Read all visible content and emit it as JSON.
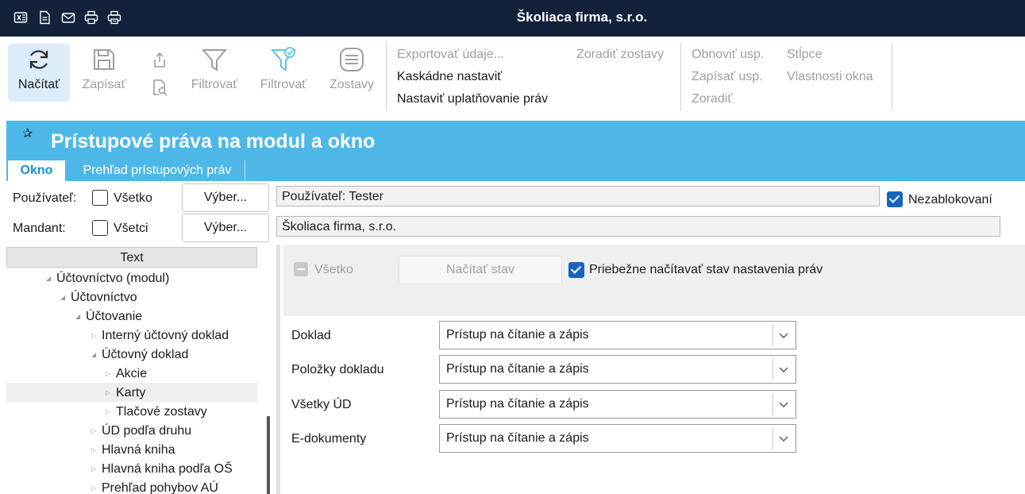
{
  "window": {
    "title": "Školiaca firma, s.r.o."
  },
  "titlebar_icons": [
    "excel-icon",
    "document-icon",
    "mail-icon",
    "print-icon",
    "print-preview-icon"
  ],
  "ribbon": {
    "load_label": "Načítať",
    "save_label": "Zapísať",
    "filter_label": "Filtrovať",
    "filter2_label": "Filtrovať",
    "reports_label": "Zostavy",
    "export_label": "Exportovať údaje...",
    "cascade_label": "Kaskádne nastaviť",
    "apply_rights_label": "Nastaviť uplatňovanie práv",
    "sort_reports_label": "Zoradiť zostavy",
    "refresh_usp_label": "Obnoviť usp.",
    "write_usp_label": "Zapísať usp.",
    "sort_label": "Zoradiť",
    "columns_label": "Stĺpce",
    "window_props_label": "Vlastnosti okna"
  },
  "page": {
    "title": "Prístupové práva na modul a okno"
  },
  "tabs": [
    {
      "label": "Okno",
      "active": true
    },
    {
      "label": "Prehľad prístupových práv",
      "active": false
    }
  ],
  "filters": {
    "user_label": "Používateľ:",
    "user_all_label": "Všetko",
    "user_all_checked": false,
    "user_select_label": "Výber...",
    "user_value": "Používateľ: Tester",
    "mandant_label": "Mandant:",
    "mandant_all_label": "Všetci",
    "mandant_all_checked": false,
    "mandant_select_label": "Výber...",
    "mandant_value": "Školiaca firma, s.r.o.",
    "unblocked_label": "Nezablokovaní",
    "unblocked_checked": true
  },
  "tree": {
    "header": "Text",
    "nodes": [
      {
        "label": "Účtovníctvo (modul)",
        "expanded": true
      },
      {
        "label": "Účtovníctvo",
        "expanded": true
      },
      {
        "label": "Účtovanie",
        "expanded": true
      },
      {
        "label": "Interný účtovný doklad",
        "expanded": false
      },
      {
        "label": "Účtovný doklad",
        "expanded": true
      },
      {
        "label": "Akcie",
        "expanded": false
      },
      {
        "label": "Karty",
        "expanded": false,
        "selected": true
      },
      {
        "label": "Tlačové zostavy",
        "expanded": false
      },
      {
        "label": "ÚD podľa druhu",
        "expanded": false
      },
      {
        "label": "Hlavná kniha",
        "expanded": false
      },
      {
        "label": "Hlavná kniha podľa OŠ",
        "expanded": false
      },
      {
        "label": "Prehľad pohybov AÚ",
        "expanded": false
      }
    ]
  },
  "rights_panel": {
    "all_label": "Všetko",
    "load_state_label": "Načítať stav",
    "continuous_label": "Priebežne načítavať stav nastavenia práv",
    "continuous_checked": true
  },
  "permissions": [
    {
      "label": "Doklad",
      "value": "Prístup na čítanie a zápis"
    },
    {
      "label": "Položky dokladu",
      "value": "Prístup na čítanie a zápis"
    },
    {
      "label": "Všetky ÚD",
      "value": "Prístup na čítanie a zápis"
    },
    {
      "label": "E-dokumenty",
      "value": "Prístup na čítanie a zápis"
    }
  ],
  "colors": {
    "titlebar": "#13213a",
    "header": "#4db8e8",
    "accent": "#1565c0",
    "disabled": "#9aa0a6"
  }
}
